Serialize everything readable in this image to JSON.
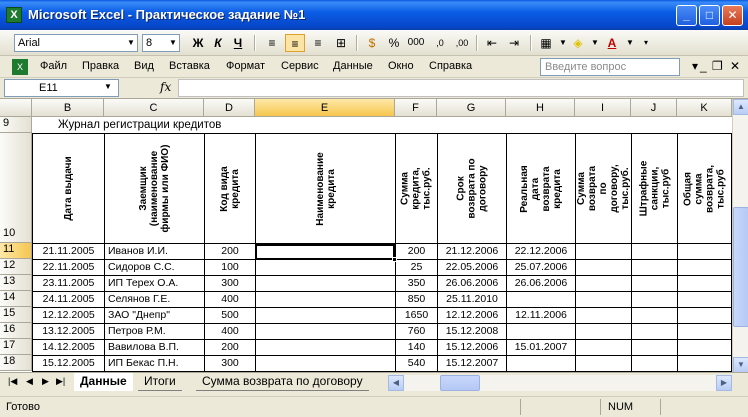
{
  "window": {
    "title": "Microsoft Excel - Практическое задание №1",
    "app_icon_glyph": "X"
  },
  "toolbar": {
    "font_name": "Arial",
    "font_size": "8",
    "bold": "Ж",
    "italic": "К",
    "underline": "Ч",
    "percent": "%",
    "thousands": "000"
  },
  "menu": {
    "items": [
      "Файл",
      "Правка",
      "Вид",
      "Вставка",
      "Формат",
      "Сервис",
      "Данные",
      "Окно",
      "Справка"
    ],
    "help_placeholder": "Введите вопрос"
  },
  "formula_bar": {
    "cell_ref": "E11",
    "fx": "fx",
    "value": ""
  },
  "grid": {
    "columns": [
      "B",
      "C",
      "D",
      "E",
      "F",
      "G",
      "H",
      "I",
      "J",
      "K"
    ],
    "selected_column": "E",
    "title_row": {
      "row": "9",
      "text": "Журнал регистрации кредитов"
    },
    "header_row": "10",
    "headers": [
      "Дата выдачи",
      "Заемщик (наименование фирмы или ФИО)",
      "Код вида кредита",
      "Наименование кредита",
      "Сумма кредита, тыс.руб.",
      "Срок возврата по договору",
      "Реальная дата возврата кредита",
      "Сумма возврата по договору, тыс.руб.",
      "Штрафные санкции, тыс.руб",
      "Общая сумма возврата, тыс.руб"
    ],
    "rows": [
      {
        "n": "11",
        "date": "21.11.2005",
        "borrower": "Иванов И.И.",
        "code": "200",
        "amount": "200",
        "due": "21.12.2006",
        "real": "22.12.2006"
      },
      {
        "n": "12",
        "date": "22.11.2005",
        "borrower": "Сидоров С.С.",
        "code": "100",
        "amount": "25",
        "due": "22.05.2006",
        "real": "25.07.2006"
      },
      {
        "n": "13",
        "date": "23.11.2005",
        "borrower": "ИП Терех О.А.",
        "code": "300",
        "amount": "350",
        "due": "26.06.2006",
        "real": "26.06.2006"
      },
      {
        "n": "14",
        "date": "24.11.2005",
        "borrower": "Селянов Г.Е.",
        "code": "400",
        "amount": "850",
        "due": "25.11.2010",
        "real": ""
      },
      {
        "n": "15",
        "date": "12.12.2005",
        "borrower": "ЗАО \"Днепр\"",
        "code": "500",
        "amount": "1650",
        "due": "12.12.2006",
        "real": "12.11.2006"
      },
      {
        "n": "16",
        "date": "13.12.2005",
        "borrower": "Петров Р.М.",
        "code": "400",
        "amount": "760",
        "due": "15.12.2008",
        "real": ""
      },
      {
        "n": "17",
        "date": "14.12.2005",
        "borrower": "Вавилова В.П.",
        "code": "200",
        "amount": "140",
        "due": "15.12.2006",
        "real": "15.01.2007"
      },
      {
        "n": "18",
        "date": "15.12.2005",
        "borrower": "ИП Бекас П.Н.",
        "code": "300",
        "amount": "540",
        "due": "15.12.2007",
        "real": ""
      }
    ]
  },
  "sheets": {
    "tabs": [
      "Данные",
      "Итоги",
      "Сумма возврата по договору"
    ],
    "active": "Данные"
  },
  "status": {
    "text": "Готово",
    "num": "NUM"
  }
}
